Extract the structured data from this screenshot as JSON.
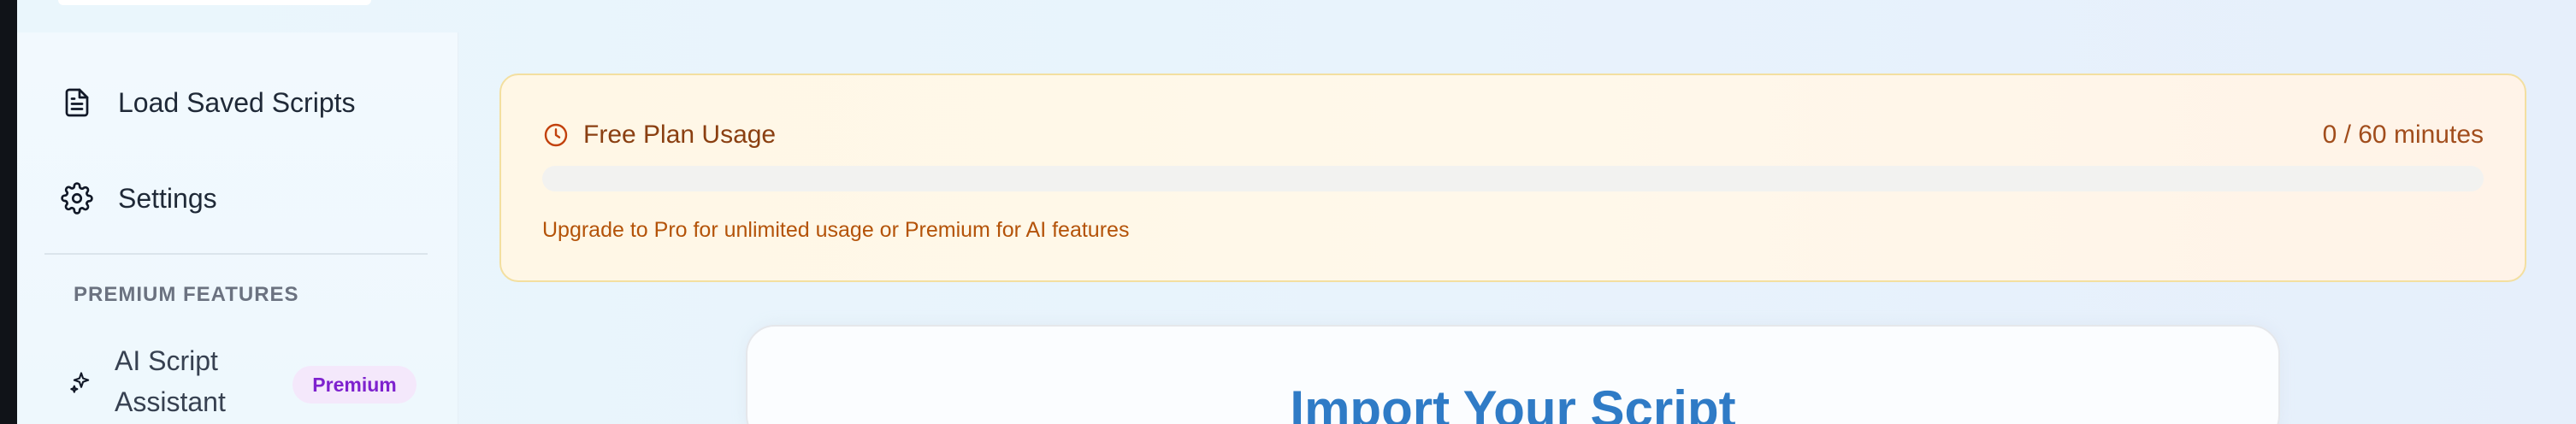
{
  "sidebar": {
    "items": [
      {
        "label": "Load Saved Scripts",
        "icon": "document-icon"
      },
      {
        "label": "Settings",
        "icon": "gear-icon"
      }
    ],
    "section_label": "PREMIUM FEATURES",
    "premium_items": [
      {
        "label": "AI Script Assistant",
        "icon": "sparkle-icon",
        "badge": "Premium"
      }
    ]
  },
  "usage": {
    "title": "Free Plan Usage",
    "minutes": "0 / 60 minutes",
    "progress_fraction": 0,
    "note": "Upgrade to Pro for unlimited usage or Premium for AI features",
    "icon": "clock-icon"
  },
  "main": {
    "import_title": "Import Your Script"
  },
  "colors": {
    "usage_title": "#8a3f11",
    "usage_note": "#b45309",
    "accent_blue": "#2f7bc6",
    "premium_badge_bg": "#f4e8fb",
    "premium_badge_text": "#7e22ce"
  }
}
